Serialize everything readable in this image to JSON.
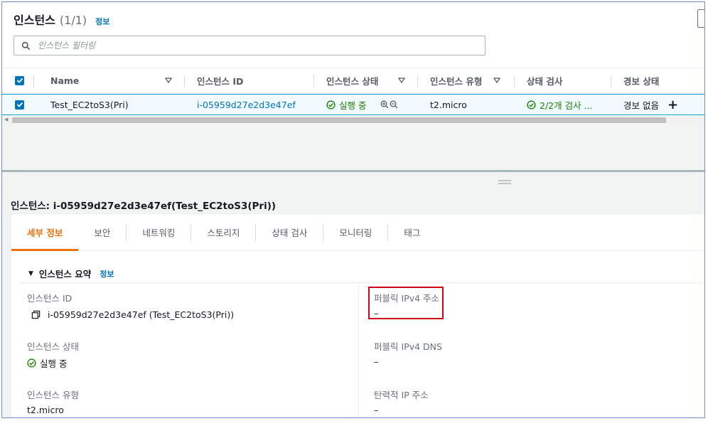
{
  "list_panel": {
    "title": "인스턴스",
    "count": "(1/1)",
    "info_label": "정보",
    "filter_placeholder": "인스턴스 필터링"
  },
  "table": {
    "columns": [
      {
        "label": "Name"
      },
      {
        "label": "인스턴스 ID"
      },
      {
        "label": "인스턴스 상태"
      },
      {
        "label": "인스턴스 유형"
      },
      {
        "label": "상태 검사"
      },
      {
        "label": "경보 상태"
      }
    ],
    "rows": [
      {
        "name": "Test_EC2toS3(Pri)",
        "instance_id": "i-05959d27e2d3e47ef",
        "state": "실행 중",
        "type": "t2.micro",
        "status_check": "2/2개 검사 ...",
        "alarm": "경보 없음"
      }
    ]
  },
  "detail": {
    "title": "인스턴스: i-05959d27e2d3e47ef(Test_EC2toS3(Pri))",
    "tabs": [
      "세부 정보",
      "보안",
      "네트워킹",
      "스토리지",
      "상태 검사",
      "모니터링",
      "태그"
    ],
    "active_tab": "세부 정보",
    "section_title": "인스턴스 요약",
    "section_info": "정보",
    "fields_left": [
      {
        "label": "인스턴스 ID",
        "value": "i-05959d27e2d3e47ef (Test_EC2toS3(Pri))"
      },
      {
        "label": "인스턴스 상태",
        "value": "실행 중"
      },
      {
        "label": "인스턴스 유형",
        "value": "t2.micro"
      }
    ],
    "fields_right": [
      {
        "label": "퍼블릭 IPv4 주소",
        "value": "–"
      },
      {
        "label": "퍼블릭 IPv4 DNS",
        "value": "–"
      },
      {
        "label": "탄력적 IP 주소",
        "value": "–"
      }
    ]
  },
  "colors": {
    "link": "#0073bb",
    "success": "#1d8102",
    "active_tab": "#ec7211",
    "selected_row": "#f1faff",
    "highlight": "#d0021b"
  }
}
